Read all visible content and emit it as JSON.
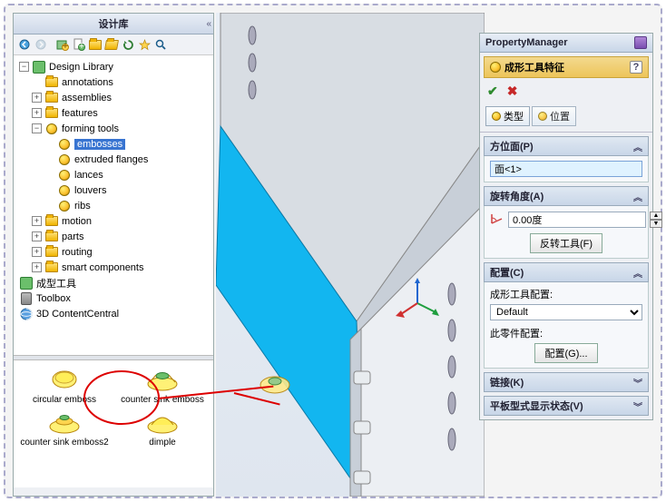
{
  "leftPanel": {
    "title": "设计库",
    "toolbar_icons": [
      "back-icon",
      "forward-icon",
      "home-icon",
      "add-file-icon",
      "add-folder-icon",
      "open-folder-icon",
      "refresh-icon",
      "pin-icon",
      "search-icon"
    ],
    "tree": {
      "root": "Design Library",
      "items": [
        {
          "lbl": "annotations",
          "type": "folder",
          "depth": 2,
          "tg": ""
        },
        {
          "lbl": "assemblies",
          "type": "folder",
          "depth": 2,
          "tg": "+"
        },
        {
          "lbl": "features",
          "type": "folder",
          "depth": 2,
          "tg": "+"
        },
        {
          "lbl": "forming tools",
          "type": "folder",
          "depth": 2,
          "tg": "-",
          "children": [
            {
              "lbl": "embosses",
              "type": "form",
              "depth": 3,
              "sel": true
            },
            {
              "lbl": "extruded flanges",
              "type": "form",
              "depth": 3
            },
            {
              "lbl": "lances",
              "type": "form",
              "depth": 3
            },
            {
              "lbl": "louvers",
              "type": "form",
              "depth": 3
            },
            {
              "lbl": "ribs",
              "type": "form",
              "depth": 3
            }
          ]
        },
        {
          "lbl": "motion",
          "type": "folder",
          "depth": 2,
          "tg": "+"
        },
        {
          "lbl": "parts",
          "type": "folder",
          "depth": 2,
          "tg": "+"
        },
        {
          "lbl": "routing",
          "type": "folder",
          "depth": 2,
          "tg": "+"
        },
        {
          "lbl": "smart components",
          "type": "folder",
          "depth": 2,
          "tg": "+"
        }
      ],
      "extras": [
        {
          "lbl": "成型工具",
          "icon": "dl"
        },
        {
          "lbl": "Toolbox",
          "icon": "toolbox"
        },
        {
          "lbl": "3D ContentCentral",
          "icon": "3dcc"
        }
      ]
    },
    "preview": [
      {
        "lbl": "circular emboss",
        "shape": "flat"
      },
      {
        "lbl": "counter sink emboss",
        "shape": "cone"
      },
      {
        "lbl": "counter sink emboss2",
        "shape": "cone2"
      },
      {
        "lbl": "dimple",
        "shape": "dimple"
      }
    ]
  },
  "pm": {
    "header": "PropertyManager",
    "feature_title": "成形工具特征",
    "tabs": {
      "type": "类型",
      "position": "位置"
    },
    "sec_placement": {
      "title": "方位面(P)",
      "value": "面<1>"
    },
    "sec_rotation": {
      "title": "旋转角度(A)",
      "value": "0.00度",
      "flip_btn": "反转工具(F)"
    },
    "sec_config": {
      "title": "配置(C)",
      "lbl1": "成形工具配置:",
      "select": "Default",
      "lbl2": "此零件配置:",
      "btn": "配置(G)..."
    },
    "sec_link": {
      "title": "链接(K)"
    },
    "sec_flat": {
      "title": "平板型式显示状态(V)"
    }
  }
}
